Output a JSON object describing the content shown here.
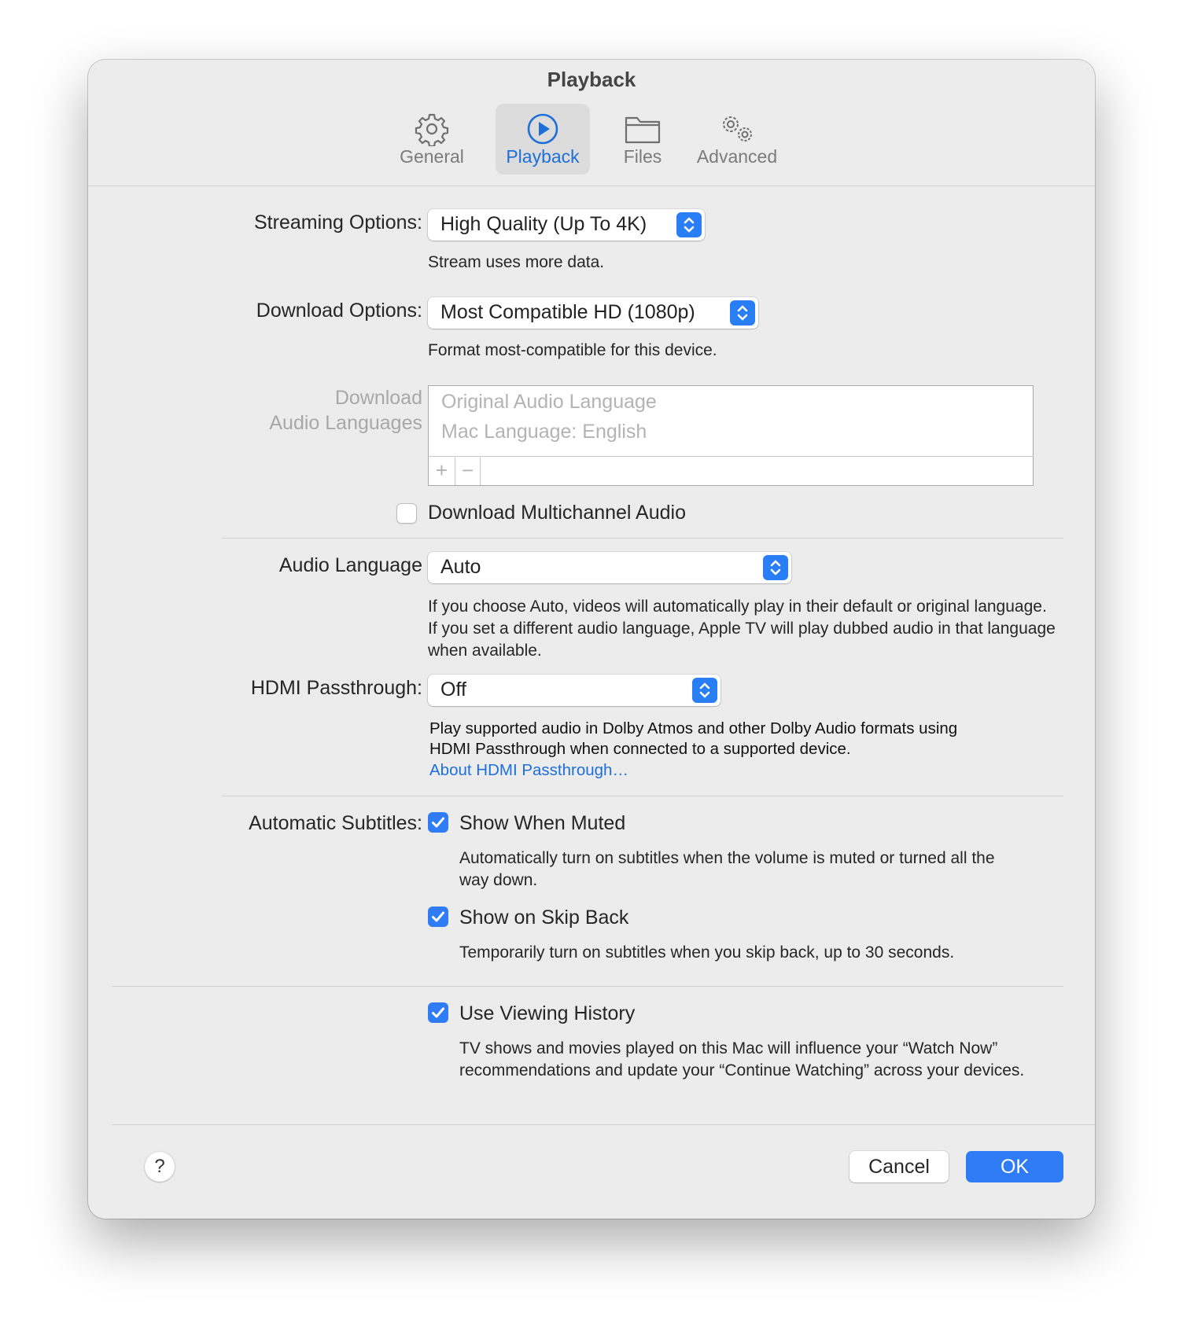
{
  "window": {
    "title": "Playback"
  },
  "tabs": [
    {
      "label": "General",
      "icon": "gear-icon"
    },
    {
      "label": "Playback",
      "icon": "play-circle-icon",
      "active": true
    },
    {
      "label": "Files",
      "icon": "folder-icon"
    },
    {
      "label": "Advanced",
      "icon": "gears-icon"
    }
  ],
  "streaming": {
    "label": "Streaming Options:",
    "value": "High Quality (Up To 4K)",
    "note": "Stream uses more data."
  },
  "download": {
    "label": "Download Options:",
    "value": "Most Compatible HD (1080p)",
    "note": "Format most-compatible for this device."
  },
  "download_audio": {
    "label_line1": "Download",
    "label_line2": "Audio Languages",
    "items": [
      "Original Audio Language",
      "Mac Language: English"
    ],
    "add_label": "+",
    "remove_label": "−"
  },
  "multichannel": {
    "label": "Download Multichannel Audio",
    "checked": false
  },
  "audio_language": {
    "label": "Audio Language",
    "value": "Auto",
    "note": "If you choose Auto, videos will automatically play in their default or original language. If you set a different audio language, Apple TV will play dubbed audio in that language when available."
  },
  "hdmi": {
    "label": "HDMI Passthrough:",
    "value": "Off",
    "note": "Play supported audio in Dolby Atmos and other Dolby Audio formats using HDMI Passthrough when connected to a supported device.",
    "link": "About HDMI Passthrough…"
  },
  "subtitles": {
    "label": "Automatic Subtitles:",
    "muted": {
      "label": "Show When Muted",
      "checked": true,
      "note": "Automatically turn on subtitles when the volume is muted or turned all the way down."
    },
    "skip": {
      "label": "Show on Skip Back",
      "checked": true,
      "note": "Temporarily turn on subtitles when you skip back, up to 30 seconds."
    }
  },
  "history": {
    "label": "Use Viewing History",
    "checked": true,
    "note": "TV shows and movies played on this Mac will influence your “Watch Now” recommendations and update your “Continue Watching” across your devices."
  },
  "footer": {
    "help_label": "?",
    "cancel_label": "Cancel",
    "ok_label": "OK"
  },
  "colors": {
    "accent": "#2f7cf6",
    "link": "#1e6fd9",
    "window_bg": "#ececec"
  }
}
